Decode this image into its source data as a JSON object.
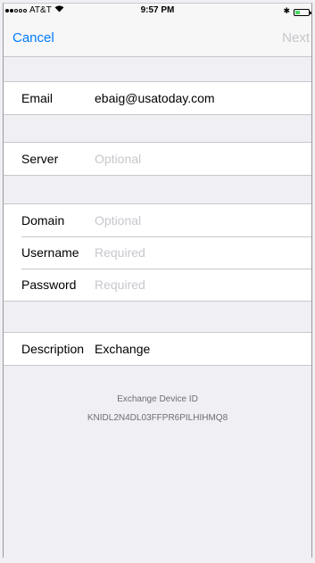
{
  "status_bar": {
    "carrier": "AT&T",
    "time": "9:57 PM"
  },
  "nav": {
    "cancel": "Cancel",
    "next": "Next"
  },
  "form": {
    "email": {
      "label": "Email",
      "value": "ebaig@usatoday.com"
    },
    "server": {
      "label": "Server",
      "placeholder": "Optional"
    },
    "domain": {
      "label": "Domain",
      "placeholder": "Optional"
    },
    "username": {
      "label": "Username",
      "placeholder": "Required"
    },
    "password": {
      "label": "Password",
      "placeholder": "Required"
    },
    "description": {
      "label": "Description",
      "value": "Exchange"
    }
  },
  "footer": {
    "title": "Exchange Device ID",
    "device_id": "KNIDL2N4DL03FFPR6PILHIHMQ8"
  },
  "colors": {
    "accent": "#007aff",
    "disabled": "#c7c7cc",
    "background": "#efeff4"
  }
}
